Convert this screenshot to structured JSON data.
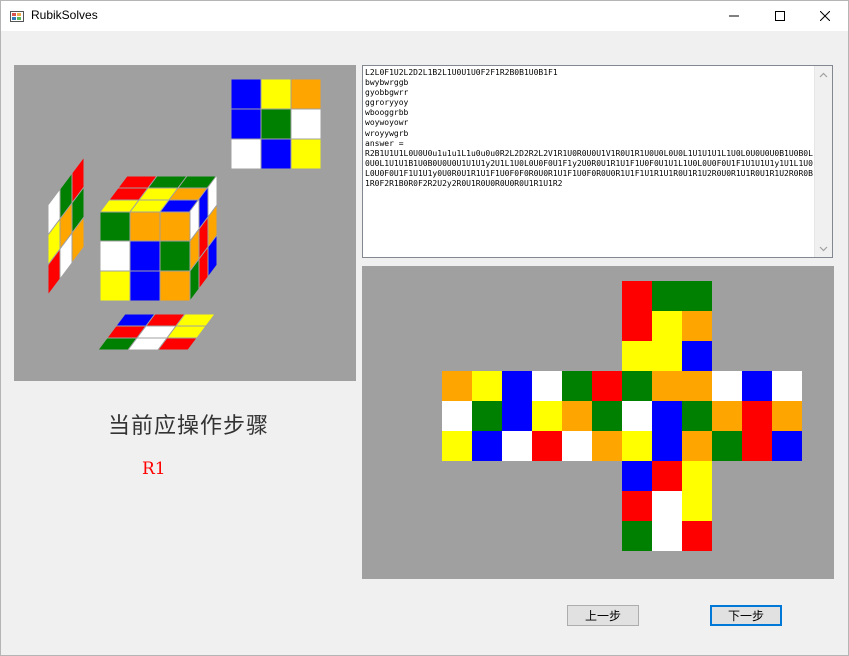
{
  "window": {
    "title": "RubikSolves"
  },
  "colors": {
    "w": "#ffffff",
    "y": "#ffff00",
    "b": "#0000ff",
    "g": "#008000",
    "r": "#ff0000",
    "o": "#ffa500"
  },
  "output": {
    "text": "L2L0F1U2L2D2L1B2L1U0U1U0F2F1R2B0B1U0B1F1\nbwybwrggb\ngyobbgwrr\nggroryyoy\nwbooggrbb\nwoywoyowr\nwroyywgrb\nanswer =\nR2B1U1U1L0U0U0u1u1u1L1u0u0u0R2L2D2R2L2V1R1U0R0U0U1V1R0U1R1U0U0L0U0L1U1U1U1L1U0L0U0U0U0B1U0B0L0U0L1U1U1B1U0B0U0U0U1U1U1y2U1L1U0L0U0F0U1F1y2U0R0U1R1U1F1U0F0U1U1L1U0L0U0F0U1F1U1U1U1y1U1L1U0L0U0F0U1F1U1U1y0U0R0U1R1U1F1U0F0F0R0U0R1U1F1U0F0R0U0R1U1F1U1R1U1R0U1R1U2R0U0R1U1R0U1R1U2R0R0B1R0F2R1B0R0F2R2U2y2R0U1R0U0R0U0R0U1R1U1R2"
  },
  "current_step": {
    "label": "当前应操作步骤",
    "move": "R1"
  },
  "buttons": {
    "prev": "上一步",
    "next": "下一步"
  },
  "cube_net": {
    "up": [
      "r",
      "g",
      "g",
      "r",
      "y",
      "o",
      "y",
      "y",
      "b"
    ],
    "left": [
      "o",
      "y",
      "b",
      "w",
      "g",
      "b",
      "y",
      "b",
      "w"
    ],
    "front": [
      "w",
      "g",
      "r",
      "y",
      "o",
      "g",
      "r",
      "w",
      "o"
    ],
    "right": [
      "g",
      "o",
      "o",
      "w",
      "b",
      "g",
      "y",
      "b",
      "o"
    ],
    "back": [
      "w",
      "b",
      "w",
      "o",
      "r",
      "o",
      "g",
      "r",
      "b"
    ],
    "down": [
      "b",
      "r",
      "y",
      "r",
      "w",
      "y",
      "g",
      "w",
      "r"
    ]
  },
  "cube_3d": {
    "front": [
      "g",
      "o",
      "o",
      "w",
      "b",
      "g",
      "y",
      "b",
      "o"
    ],
    "top": [
      "r",
      "g",
      "g",
      "r",
      "y",
      "o",
      "y",
      "y",
      "b"
    ],
    "right": [
      "w",
      "b",
      "w",
      "o",
      "r",
      "o",
      "g",
      "r",
      "b"
    ],
    "back_floating": [
      "b",
      "y",
      "o",
      "b",
      "g",
      "w",
      "w",
      "b",
      "y"
    ],
    "left_floating": [
      "w",
      "g",
      "r",
      "y",
      "o",
      "g",
      "r",
      "w",
      "o"
    ],
    "bottom_floating": [
      "b",
      "r",
      "y",
      "r",
      "w",
      "y",
      "g",
      "w",
      "r"
    ]
  }
}
